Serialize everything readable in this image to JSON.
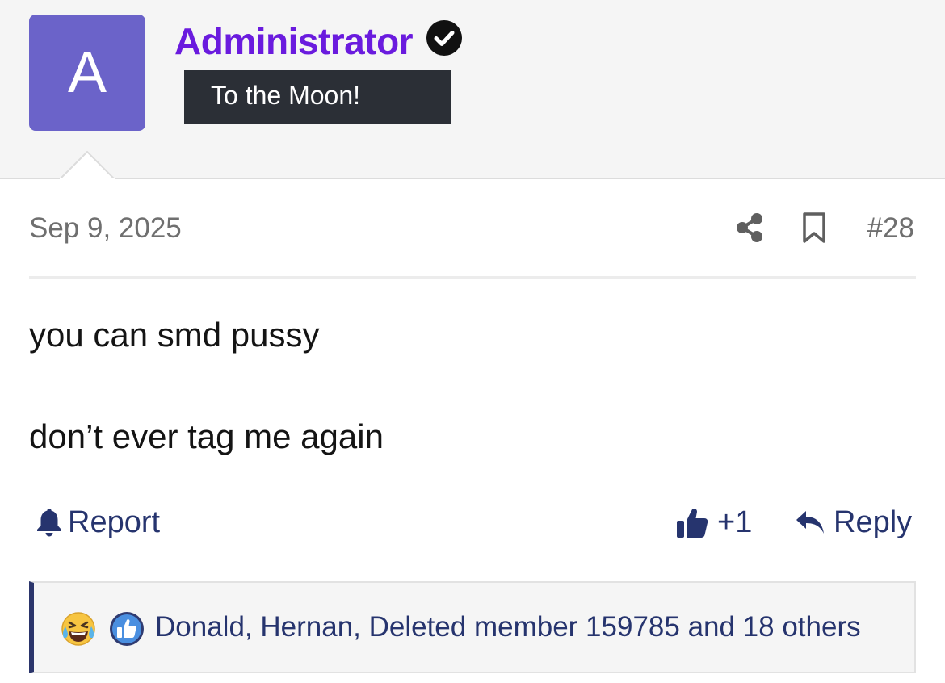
{
  "user": {
    "avatar_letter": "A",
    "avatar_color": "#6b63c9",
    "username": "Administrator",
    "username_color": "#6a1bde",
    "verified_icon": "check-circle-icon",
    "title": "To the Moon!"
  },
  "post": {
    "date": "Sep 9, 2025",
    "number": "#28",
    "meta_icons": [
      "share-icon",
      "bookmark-icon"
    ],
    "message_lines": [
      "you can smd pussy",
      "don’t ever tag me again"
    ]
  },
  "actions": {
    "report_label": "Report",
    "report_icon": "bell-icon",
    "like_label": "+1",
    "like_icon": "thumbs-up-icon",
    "reply_label": "Reply",
    "reply_icon": "reply-arrow-icon",
    "accent_color": "#26346e"
  },
  "reactions": {
    "icons": [
      "laughing-crying-emoji-icon",
      "like-reaction-icon"
    ],
    "summary": "Donald, Hernan, Deleted member 159785 and 18 others"
  }
}
